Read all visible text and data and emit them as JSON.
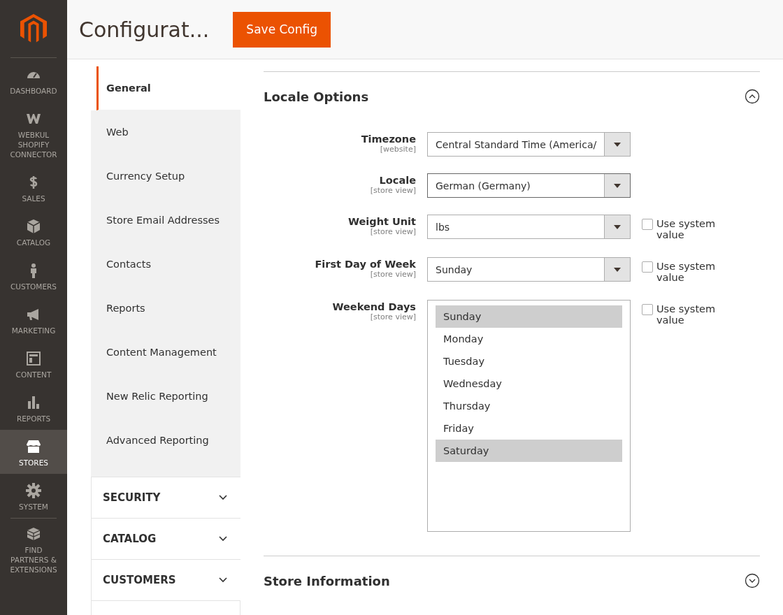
{
  "sidebar": {
    "items": [
      {
        "label": "DASHBOARD",
        "selected": false
      },
      {
        "label": "WEBKUL SHOPIFY CONNECTOR",
        "selected": false
      },
      {
        "label": "SALES",
        "selected": false
      },
      {
        "label": "CATALOG",
        "selected": false
      },
      {
        "label": "CUSTOMERS",
        "selected": false
      },
      {
        "label": "MARKETING",
        "selected": false
      },
      {
        "label": "CONTENT",
        "selected": false
      },
      {
        "label": "REPORTS",
        "selected": false
      },
      {
        "label": "STORES",
        "selected": true
      },
      {
        "label": "SYSTEM",
        "selected": false
      },
      {
        "label": "FIND PARTNERS & EXTENSIONS",
        "selected": false
      }
    ]
  },
  "header": {
    "title": "Configurat...",
    "save_button": "Save Config"
  },
  "config_nav": {
    "items": [
      {
        "label": "General",
        "selected": true
      },
      {
        "label": "Web",
        "selected": false
      },
      {
        "label": "Currency Setup",
        "selected": false
      },
      {
        "label": "Store Email Addresses",
        "selected": false
      },
      {
        "label": "Contacts",
        "selected": false
      },
      {
        "label": "Reports",
        "selected": false
      },
      {
        "label": "Content Management",
        "selected": false
      },
      {
        "label": "New Relic Reporting",
        "selected": false
      },
      {
        "label": "Advanced Reporting",
        "selected": false
      }
    ],
    "sections": [
      {
        "label": "SECURITY",
        "expanded": false
      },
      {
        "label": "CATALOG",
        "expanded": false
      },
      {
        "label": "CUSTOMERS",
        "expanded": false
      }
    ]
  },
  "groups": [
    {
      "title": "Locale Options",
      "expanded": true,
      "fields": [
        {
          "kind": "select",
          "label": "Timezone",
          "scope": "[website]",
          "value": "Central Standard Time (America/",
          "focused": false
        },
        {
          "kind": "select",
          "label": "Locale",
          "scope": "[store view]",
          "value": "German (Germany)",
          "focused": true
        },
        {
          "kind": "select",
          "label": "Weight Unit",
          "scope": "[store view]",
          "value": "lbs",
          "focused": false,
          "use_system_value": {
            "label": "Use system value",
            "checked": false
          }
        },
        {
          "kind": "select",
          "label": "First Day of Week",
          "scope": "[store view]",
          "value": "Sunday",
          "focused": false,
          "use_system_value": {
            "label": "Use system value",
            "checked": false
          }
        },
        {
          "kind": "multiselect",
          "label": "Weekend Days",
          "scope": "[store view]",
          "options": [
            {
              "label": "Sunday",
              "selected": true
            },
            {
              "label": "Monday",
              "selected": false
            },
            {
              "label": "Tuesday",
              "selected": false
            },
            {
              "label": "Wednesday",
              "selected": false
            },
            {
              "label": "Thursday",
              "selected": false
            },
            {
              "label": "Friday",
              "selected": false
            },
            {
              "label": "Saturday",
              "selected": true
            }
          ],
          "use_system_value": {
            "label": "Use system value",
            "checked": false
          }
        }
      ]
    },
    {
      "title": "Store Information",
      "expanded": false
    }
  ]
}
